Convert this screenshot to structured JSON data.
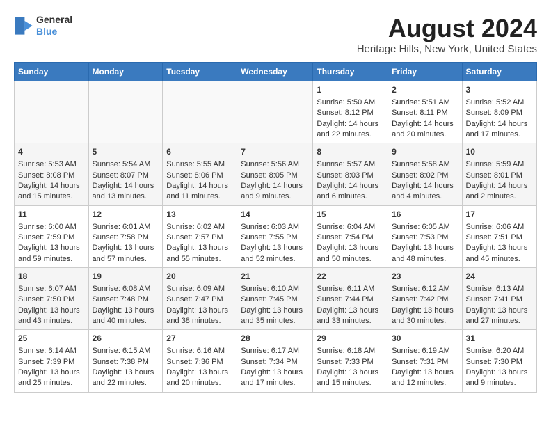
{
  "logo": {
    "line1": "General",
    "line2": "Blue"
  },
  "title": "August 2024",
  "subtitle": "Heritage Hills, New York, United States",
  "days_of_week": [
    "Sunday",
    "Monday",
    "Tuesday",
    "Wednesday",
    "Thursday",
    "Friday",
    "Saturday"
  ],
  "weeks": [
    [
      {
        "day": "",
        "data": ""
      },
      {
        "day": "",
        "data": ""
      },
      {
        "day": "",
        "data": ""
      },
      {
        "day": "",
        "data": ""
      },
      {
        "day": "1",
        "data": "Sunrise: 5:50 AM\nSunset: 8:12 PM\nDaylight: 14 hours and 22 minutes."
      },
      {
        "day": "2",
        "data": "Sunrise: 5:51 AM\nSunset: 8:11 PM\nDaylight: 14 hours and 20 minutes."
      },
      {
        "day": "3",
        "data": "Sunrise: 5:52 AM\nSunset: 8:09 PM\nDaylight: 14 hours and 17 minutes."
      }
    ],
    [
      {
        "day": "4",
        "data": "Sunrise: 5:53 AM\nSunset: 8:08 PM\nDaylight: 14 hours and 15 minutes."
      },
      {
        "day": "5",
        "data": "Sunrise: 5:54 AM\nSunset: 8:07 PM\nDaylight: 14 hours and 13 minutes."
      },
      {
        "day": "6",
        "data": "Sunrise: 5:55 AM\nSunset: 8:06 PM\nDaylight: 14 hours and 11 minutes."
      },
      {
        "day": "7",
        "data": "Sunrise: 5:56 AM\nSunset: 8:05 PM\nDaylight: 14 hours and 9 minutes."
      },
      {
        "day": "8",
        "data": "Sunrise: 5:57 AM\nSunset: 8:03 PM\nDaylight: 14 hours and 6 minutes."
      },
      {
        "day": "9",
        "data": "Sunrise: 5:58 AM\nSunset: 8:02 PM\nDaylight: 14 hours and 4 minutes."
      },
      {
        "day": "10",
        "data": "Sunrise: 5:59 AM\nSunset: 8:01 PM\nDaylight: 14 hours and 2 minutes."
      }
    ],
    [
      {
        "day": "11",
        "data": "Sunrise: 6:00 AM\nSunset: 7:59 PM\nDaylight: 13 hours and 59 minutes."
      },
      {
        "day": "12",
        "data": "Sunrise: 6:01 AM\nSunset: 7:58 PM\nDaylight: 13 hours and 57 minutes."
      },
      {
        "day": "13",
        "data": "Sunrise: 6:02 AM\nSunset: 7:57 PM\nDaylight: 13 hours and 55 minutes."
      },
      {
        "day": "14",
        "data": "Sunrise: 6:03 AM\nSunset: 7:55 PM\nDaylight: 13 hours and 52 minutes."
      },
      {
        "day": "15",
        "data": "Sunrise: 6:04 AM\nSunset: 7:54 PM\nDaylight: 13 hours and 50 minutes."
      },
      {
        "day": "16",
        "data": "Sunrise: 6:05 AM\nSunset: 7:53 PM\nDaylight: 13 hours and 48 minutes."
      },
      {
        "day": "17",
        "data": "Sunrise: 6:06 AM\nSunset: 7:51 PM\nDaylight: 13 hours and 45 minutes."
      }
    ],
    [
      {
        "day": "18",
        "data": "Sunrise: 6:07 AM\nSunset: 7:50 PM\nDaylight: 13 hours and 43 minutes."
      },
      {
        "day": "19",
        "data": "Sunrise: 6:08 AM\nSunset: 7:48 PM\nDaylight: 13 hours and 40 minutes."
      },
      {
        "day": "20",
        "data": "Sunrise: 6:09 AM\nSunset: 7:47 PM\nDaylight: 13 hours and 38 minutes."
      },
      {
        "day": "21",
        "data": "Sunrise: 6:10 AM\nSunset: 7:45 PM\nDaylight: 13 hours and 35 minutes."
      },
      {
        "day": "22",
        "data": "Sunrise: 6:11 AM\nSunset: 7:44 PM\nDaylight: 13 hours and 33 minutes."
      },
      {
        "day": "23",
        "data": "Sunrise: 6:12 AM\nSunset: 7:42 PM\nDaylight: 13 hours and 30 minutes."
      },
      {
        "day": "24",
        "data": "Sunrise: 6:13 AM\nSunset: 7:41 PM\nDaylight: 13 hours and 27 minutes."
      }
    ],
    [
      {
        "day": "25",
        "data": "Sunrise: 6:14 AM\nSunset: 7:39 PM\nDaylight: 13 hours and 25 minutes."
      },
      {
        "day": "26",
        "data": "Sunrise: 6:15 AM\nSunset: 7:38 PM\nDaylight: 13 hours and 22 minutes."
      },
      {
        "day": "27",
        "data": "Sunrise: 6:16 AM\nSunset: 7:36 PM\nDaylight: 13 hours and 20 minutes."
      },
      {
        "day": "28",
        "data": "Sunrise: 6:17 AM\nSunset: 7:34 PM\nDaylight: 13 hours and 17 minutes."
      },
      {
        "day": "29",
        "data": "Sunrise: 6:18 AM\nSunset: 7:33 PM\nDaylight: 13 hours and 15 minutes."
      },
      {
        "day": "30",
        "data": "Sunrise: 6:19 AM\nSunset: 7:31 PM\nDaylight: 13 hours and 12 minutes."
      },
      {
        "day": "31",
        "data": "Sunrise: 6:20 AM\nSunset: 7:30 PM\nDaylight: 13 hours and 9 minutes."
      }
    ]
  ]
}
